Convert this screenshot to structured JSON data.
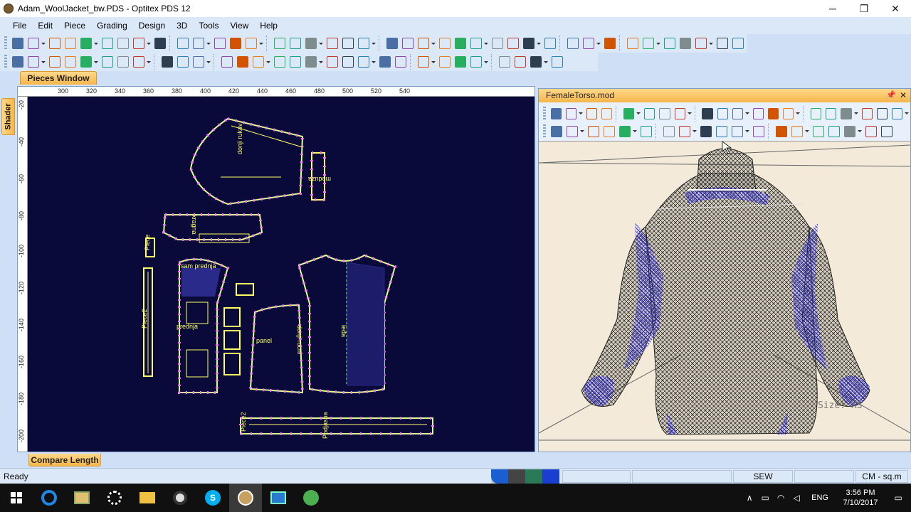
{
  "window": {
    "title": "Adam_WoolJacket_bw.PDS - Optitex PDS 12",
    "minimize": "─",
    "maximize": "❐",
    "close": "✕"
  },
  "menu": [
    "File",
    "Edit",
    "Piece",
    "Grading",
    "Design",
    "3D",
    "Tools",
    "View",
    "Help"
  ],
  "tabs": {
    "pieces_window": "Pieces Window",
    "shader": "Shader",
    "compare_length": "Compare Length"
  },
  "ruler": {
    "h_ticks": [
      "300",
      "320",
      "340",
      "360",
      "380",
      "400",
      "420",
      "440",
      "460",
      "480",
      "500",
      "520",
      "540"
    ],
    "v_ticks": [
      "-20",
      "-40",
      "-60",
      "-80",
      "-100",
      "-120",
      "-140",
      "-160",
      "-180",
      "-200"
    ]
  },
  "pieces": {
    "sleeve_label": "donji rukav",
    "collar_label": "meduza",
    "pocket_label": "kragna",
    "piece_label": "Piece",
    "piece2_label": "Piece2",
    "front_label": "sam prednja",
    "front2_label": "prednja",
    "side_label": "donji rucni",
    "back_label": "leđa",
    "panel_label": "panel",
    "ribbon_label": "Piece2",
    "bottom_label": "Podjasna"
  },
  "panel3d": {
    "title": "FemaleTorso.mod",
    "pin": "📌",
    "close": "✕",
    "size_label": "Size: XS"
  },
  "status": {
    "ready": "Ready",
    "mode": "SEW",
    "units": "CM - sq.m"
  },
  "clock": {
    "time": "3:56 PM",
    "date": "7/10/2017"
  },
  "tray": {
    "lang": "ENG"
  },
  "colors": {
    "accent": "#f6b64a",
    "canvas": "#0a0a3a",
    "piece_outline": "#ffff66",
    "notch": "#ff66ff",
    "grade": "#66ffff",
    "mesh_blue": "#2020d0"
  }
}
